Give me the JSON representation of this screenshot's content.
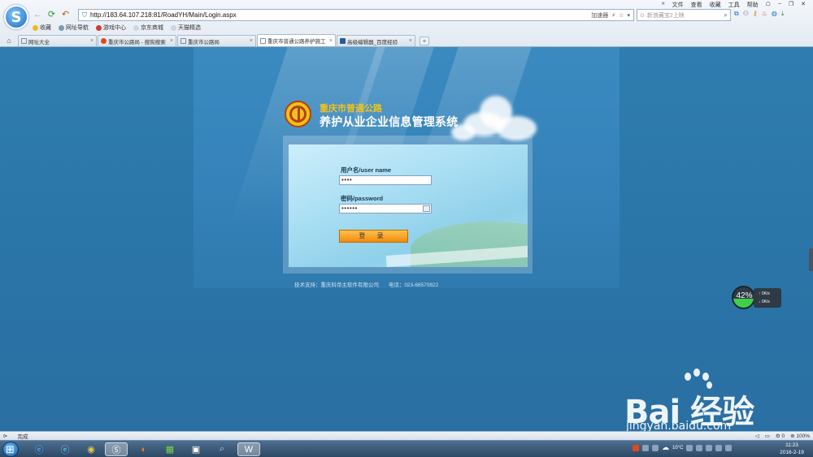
{
  "browser": {
    "menu": [
      "文件",
      "查看",
      "收藏",
      "工具",
      "帮助"
    ],
    "address_url": "http://183.64.107.218:81/RoadYH/Main/Login.aspx",
    "accelerator_label": "加速器",
    "search_placeholder": "新浪藏宝2上映",
    "bookmarks": [
      "收藏",
      "网址导航",
      "游戏中心",
      "京东商城",
      "天猫精选"
    ],
    "tabs": [
      {
        "label": "网址大全",
        "active": false
      },
      {
        "label": "重庆市公路局 - 搜狗搜索",
        "active": false
      },
      {
        "label": "重庆市公路局",
        "active": false
      },
      {
        "label": "重庆市普通公路养护施工",
        "active": true
      },
      {
        "label": "高级编辑器_百度经验",
        "active": false
      }
    ],
    "new_tab": "+"
  },
  "login_page": {
    "org_name": "重庆市普通公路",
    "system_name": "养护从业企业信息管理系统",
    "username_label": "用户名/user name",
    "username_value": "••••",
    "password_label": "密码/password",
    "password_value": "••••••",
    "login_button": "登 录",
    "support_text": "技术支持：重庆科帝主软件有限公司",
    "phone_text": "电话：023-68570822"
  },
  "speed_widget": {
    "percent": "42%",
    "up_rate": "0K/s",
    "down_rate": "0K/s",
    "fill_fraction": 0.42
  },
  "watermark": {
    "brand": "Bai 经验",
    "url": "jingyan.baidu.com"
  },
  "status_bar": {
    "status": "完成",
    "zoom": "100%",
    "count": "0"
  },
  "taskbar": {
    "weather": "10°C",
    "time": "11:23",
    "date": "2016-2-19"
  }
}
